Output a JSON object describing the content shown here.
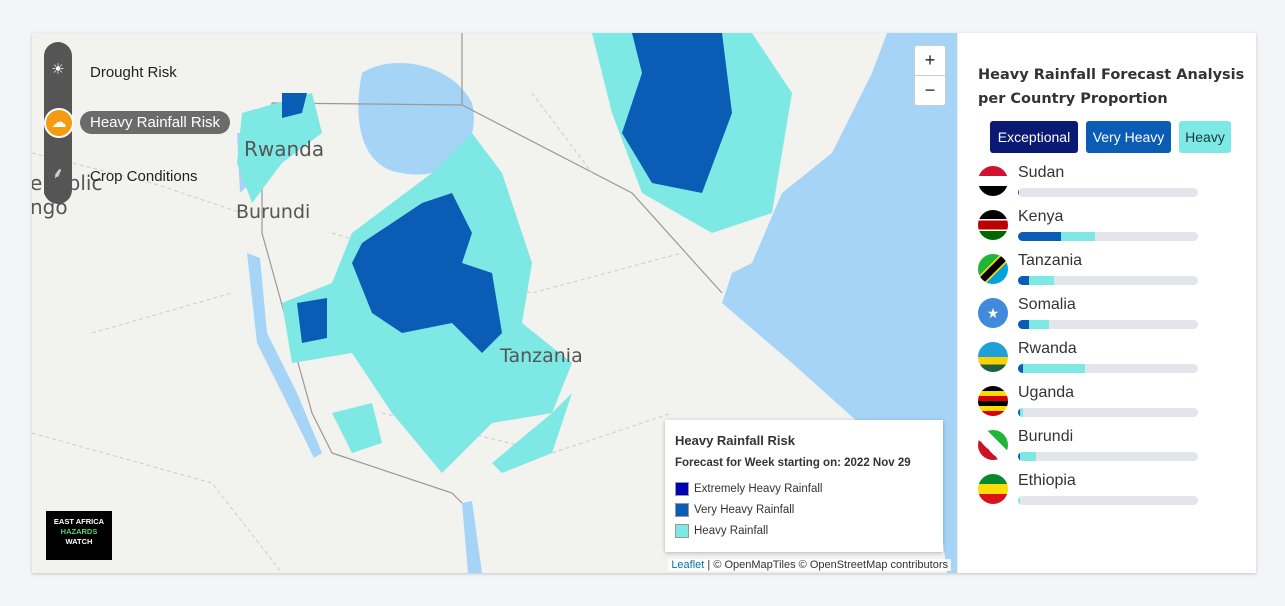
{
  "layers": [
    {
      "label": "Drought Risk",
      "icon": "drought-icon",
      "active": false
    },
    {
      "label": "Heavy Rainfall Risk",
      "icon": "rain-cloud-icon",
      "active": true
    },
    {
      "label": "Crop Conditions",
      "icon": "wheat-icon",
      "active": false
    }
  ],
  "map": {
    "labels": {
      "rwanda": "Rwanda",
      "burundi": "Burundi",
      "tanzania": "Tanzania",
      "drc1": "epublic",
      "drc2": "ngo"
    },
    "zoom_in": "+",
    "zoom_out": "−",
    "logo": {
      "line1": "EAST AFRICA",
      "line2": "HAZARDS",
      "line3": "WATCH"
    },
    "attribution": {
      "leaflet": "Leaflet",
      "rest": " | © OpenMapTiles © OpenStreetMap contributors"
    }
  },
  "legend": {
    "title": "Heavy Rainfall Risk",
    "subtitle": "Forecast for Week starting on: 2022 Nov 29",
    "items": [
      {
        "label": "Extremely Heavy Rainfall",
        "color": "#0000b3"
      },
      {
        "label": "Very Heavy Rainfall",
        "color": "#0b5cb5"
      },
      {
        "label": "Heavy Rainfall",
        "color": "#7de8e4"
      }
    ]
  },
  "panel": {
    "title": "Heavy Rainfall Forecast Analysis per Country Proportion",
    "buttons": [
      {
        "label": "Exceptional",
        "bg": "#0a1a73",
        "fg": "#ffffff"
      },
      {
        "label": "Very Heavy",
        "bg": "#0b5cb5",
        "fg": "#ffffff"
      },
      {
        "label": "Heavy",
        "bg": "#7de8e4",
        "fg": "#1a3a3a"
      }
    ],
    "countries": [
      {
        "name": "Sudan",
        "exceptional": 0,
        "very_heavy": 0.5,
        "heavy": 0
      },
      {
        "name": "Kenya",
        "exceptional": 0,
        "very_heavy": 24,
        "heavy": 19
      },
      {
        "name": "Tanzania",
        "exceptional": 0,
        "very_heavy": 6,
        "heavy": 14
      },
      {
        "name": "Somalia",
        "exceptional": 0,
        "very_heavy": 6,
        "heavy": 11
      },
      {
        "name": "Rwanda",
        "exceptional": 0,
        "very_heavy": 3,
        "heavy": 34
      },
      {
        "name": "Uganda",
        "exceptional": 0,
        "very_heavy": 1,
        "heavy": 2
      },
      {
        "name": "Burundi",
        "exceptional": 0,
        "very_heavy": 1,
        "heavy": 9
      },
      {
        "name": "Ethiopia",
        "exceptional": 0,
        "very_heavy": 0,
        "heavy": 1
      }
    ]
  }
}
